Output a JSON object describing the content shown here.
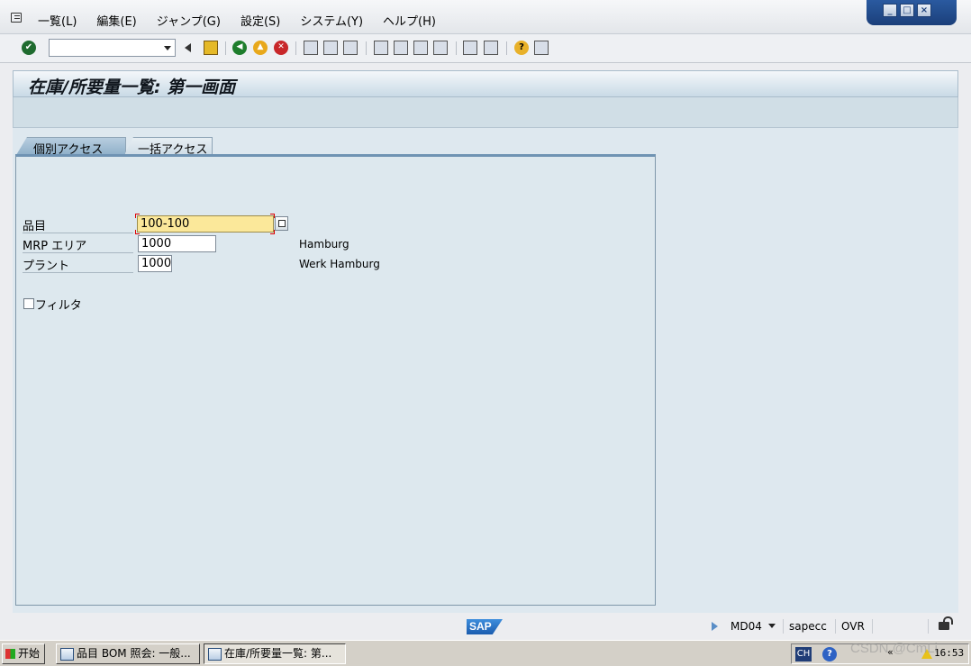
{
  "menu": {
    "items": [
      "一覧(L)",
      "編集(E)",
      "ジャンプ(G)",
      "設定(S)",
      "システム(Y)",
      "ヘルプ(H)"
    ]
  },
  "window_controls": [
    "_",
    "□",
    "×"
  ],
  "toolbar": {
    "command_field_value": "",
    "icons": [
      "enter-icon",
      "back-arrow-icon",
      "save-icon",
      "back-icon",
      "exit-icon",
      "cancel-icon",
      "print-icon",
      "find-icon",
      "find-next-icon",
      "first-page-icon",
      "previous-page-icon",
      "next-page-icon",
      "last-page-icon",
      "create-session-icon",
      "shortcut-icon",
      "help-icon",
      "layout-menu-icon"
    ]
  },
  "page": {
    "title": "在庫/所要量一覧: 第一画面"
  },
  "tabs": {
    "active": "個別アクセス",
    "inactive": "一括アクセス"
  },
  "form": {
    "material_label": "品目",
    "material_value": "100-100",
    "mrp_area_label": "MRP エリア",
    "mrp_area_value": "1000",
    "mrp_area_desc": "Hamburg",
    "plant_label": "プラント",
    "plant_value": "1000",
    "plant_desc": "Werk Hamburg",
    "filter_label": "フィルタ",
    "filter_checked": false
  },
  "status": {
    "sap_logo_text": "SAP",
    "transaction": "MD04",
    "system": "sapecc",
    "mode": "OVR"
  },
  "taskbar": {
    "start_label": "开始",
    "tasks": [
      "品目 BOM 照会: 一般...",
      "在庫/所要量一覧: 第..."
    ],
    "tray_ch": "CH",
    "tray_help": "?",
    "tray_arrows": "«",
    "clock": "16:53",
    "watermark": "CSDN @CmLi"
  },
  "colors": {
    "required_field": "#fbe89a",
    "panel_bg": "#dde8ee",
    "title_band": "#c9dae6",
    "active_tab": "#8fb0c9"
  }
}
